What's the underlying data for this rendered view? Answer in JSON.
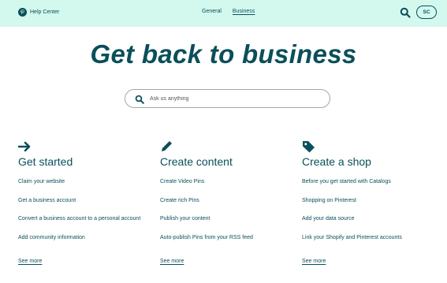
{
  "header": {
    "brand": "Help Center",
    "nav": [
      "General",
      "Business"
    ],
    "active_nav": "Business",
    "avatar_initials": "SC"
  },
  "hero": {
    "title": "Get back to business"
  },
  "search": {
    "placeholder": "Ask us anything"
  },
  "columns": [
    {
      "icon": "arrow-right-icon",
      "title": "Get started",
      "links": [
        "Claim your website",
        "Get a business account",
        "Convert a business account to a personal account",
        "Add community information"
      ],
      "see_more": "See more"
    },
    {
      "icon": "pencil-icon",
      "title": "Create content",
      "links": [
        "Create Video Pins",
        "Create rich Pins",
        "Publish your content",
        "Auto-publish Pins from your RSS feed"
      ],
      "see_more": "See more"
    },
    {
      "icon": "tag-icon",
      "title": "Create a shop",
      "links": [
        "Before you get started with Catalogs",
        "Shopping on Pinterest",
        "Add your data source",
        "Link your Shopify and Pinterest accounts"
      ],
      "see_more": "See more"
    }
  ],
  "colors": {
    "header_bg": "#d3f9ef",
    "text": "#0a4f5a"
  }
}
